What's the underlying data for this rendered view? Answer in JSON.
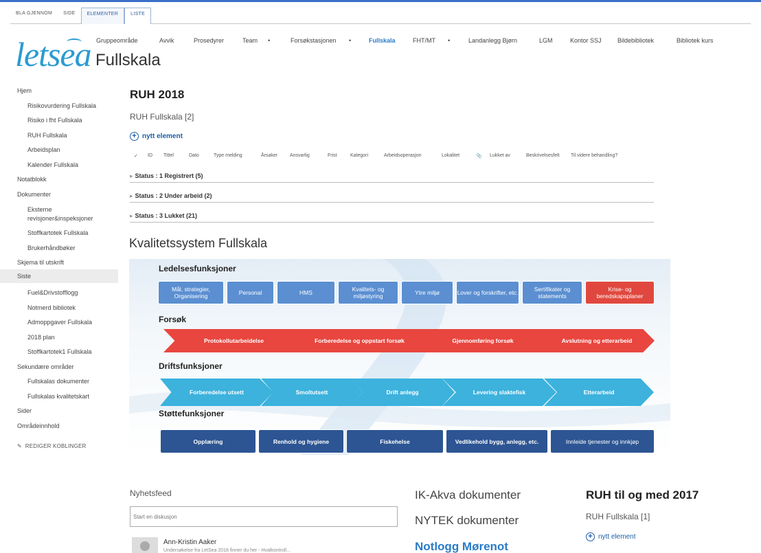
{
  "ribbon": {
    "tabs": [
      "BLA GJENNOM",
      "SIDE",
      "ELEMENTER",
      "LISTE"
    ]
  },
  "brand": {
    "logo_text": "letsea"
  },
  "page": {
    "title": "Fullskala"
  },
  "topnav": [
    "Gruppeområde",
    "Avvik",
    "Prosedyrer",
    "Team",
    "Forsøkstasjonen",
    "Fullskala",
    "FHT/MT",
    "Landanlegg Bjørn",
    "LGM",
    "Kontor SSJ",
    "Bildebibliotek",
    "Bibliotek kurs"
  ],
  "leftnav": {
    "items": [
      "Hjem",
      "Risikovurdering Fullskala",
      "Risiko i fht Fullskala",
      "RUH Fullskala",
      "Arbeidsplan",
      "Kalender Fullskala",
      "Notatblokk",
      "Dokumenter",
      "Eksterne",
      "revisjoner&inspeksjoner",
      "Stoffkartotek Fullskala",
      "Brukerhåndbøker",
      "Skjema til utskrift",
      "Siste",
      "Fuel&Drivstofflogg",
      "Notmerd bibliotek",
      "Admoppgaver Fullskala",
      "2018 plan",
      "Stoffkartotek1 Fullskala",
      "Sekundære områder",
      "Fullskalas dokumenter",
      "Fullskalas kvalitetskart",
      "Sider",
      "Områdeinnhold"
    ],
    "edit_links": "REDIGER KOBLINGER"
  },
  "ruh2018": {
    "heading": "RUH 2018",
    "list_title": "RUH Fullskala [2]",
    "new_item": "nytt element",
    "columns": [
      "✓",
      "ID",
      "Tittel",
      "Dato",
      "Type melding",
      "Årsaker",
      "Ansvarlig",
      "Frist",
      "Kategori",
      "Arbeidsoperasjon",
      "Lokalitet",
      "📎",
      "Lukket av",
      "Beskrivelsesfelt",
      "Til videre behandling?"
    ],
    "groups": [
      "Status : 1 Registrert (5)",
      "Status : 2 Under arbeid (2)",
      "Status : 3 Lukket (21)"
    ]
  },
  "kvalitet": {
    "title": "Kvalitetssystem Fullskala",
    "ledelse": {
      "heading": "Ledelsesfunksjoner",
      "boxes": [
        "Mål, strategier, Organisering",
        "Personal",
        "HMS",
        "Kvalitets- og miljøstyring",
        "Ytre miljø",
        "Lover og forskrifter, etc.",
        "Sertifikater og statements",
        "Krise- og beredskapsplaner"
      ]
    },
    "forsok": {
      "heading": "Forsøk",
      "steps": [
        "Protokollutarbeidelse",
        "Forberedelse og oppstart forsøk",
        "Gjennomføring forsøk",
        "Avslutning og etterarbeid"
      ]
    },
    "drift": {
      "heading": "Driftsfunksjoner",
      "steps": [
        "Forberedelse utsett",
        "Smoltutsett",
        "Drift anlegg",
        "Levering slaktefisk",
        "Etterarbeid"
      ]
    },
    "stotte": {
      "heading": "Støttefunksjoner",
      "boxes": [
        "Opplæring",
        "Renhold og hygiene",
        "Fiskehelse",
        "Vedlikehold bygg, anlegg, etc.",
        "Innleide tjenester og innkjøp"
      ]
    },
    "colors": {
      "blue": "#5b8fd1",
      "red": "#e0483f",
      "cyan": "#3cb2dd",
      "navy": "#2d5593"
    }
  },
  "feed": {
    "heading": "Nyhetsfeed",
    "placeholder": "Start en diskusjon",
    "user": "Ann-Kristin Aaker",
    "snippet": "Undersøkelse fra LetSea 2018 finner du her - Hvalkontroll..."
  },
  "links": [
    "IK-Akva dokumenter",
    "NYTEK dokumenter",
    "Notlogg Mørenot"
  ],
  "ruh2017": {
    "heading": "RUH til og med 2017",
    "list_title": "RUH Fullskala [1]",
    "new_item": "nytt element"
  }
}
